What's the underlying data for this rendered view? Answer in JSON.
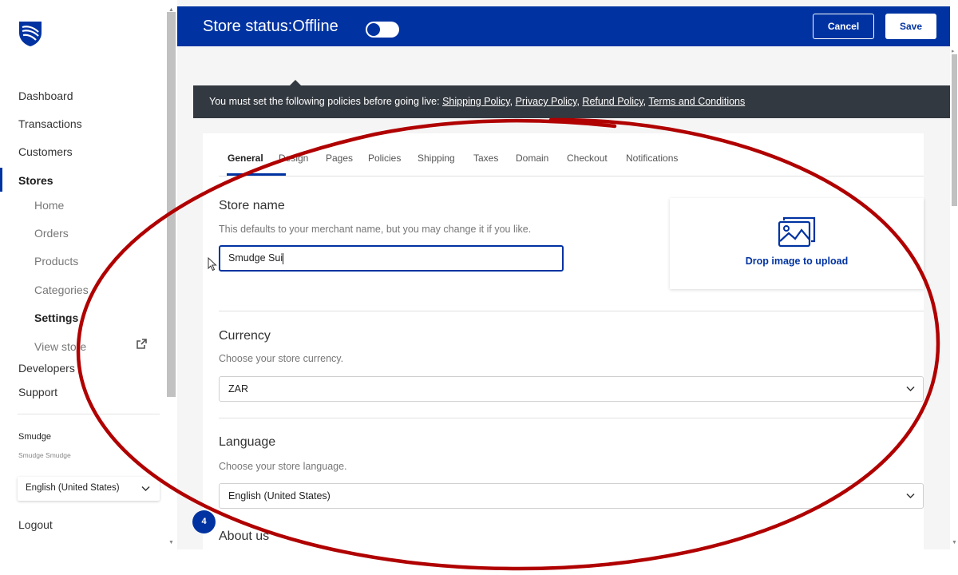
{
  "sidebar": {
    "nav": {
      "dashboard": "Dashboard",
      "transactions": "Transactions",
      "customers": "Customers",
      "stores": "Stores",
      "developers": "Developers",
      "support": "Support"
    },
    "stores_sub": {
      "home": "Home",
      "orders": "Orders",
      "products": "Products",
      "categories": "Categories",
      "settings": "Settings",
      "view_store": "View store"
    },
    "merchant": {
      "name": "Smudge",
      "subtitle": "Smudge Smudge"
    },
    "language_selected": "English (United States)",
    "logout": "Logout"
  },
  "header": {
    "store_status": "Store status:Offline",
    "toggle_on": false,
    "cancel_label": "Cancel",
    "save_label": "Save"
  },
  "policy_banner": {
    "prefix": "You must set the following policies before going live:",
    "links": [
      "Shipping Policy",
      "Privacy Policy",
      "Refund Policy",
      "Terms and Conditions"
    ]
  },
  "tabs": [
    "General",
    "Design",
    "Pages",
    "Policies",
    "Shipping",
    "Taxes",
    "Domain",
    "Checkout",
    "Notifications"
  ],
  "active_tab": "General",
  "general": {
    "store_name": {
      "title": "Store name",
      "description": "This defaults to your merchant name, but you may change it if you like.",
      "value": "Smudge Sui"
    },
    "upload": {
      "label": "Drop image to upload"
    },
    "currency": {
      "title": "Currency",
      "description": "Choose your store currency.",
      "value": "ZAR"
    },
    "language": {
      "title": "Language",
      "description": "Choose your store language.",
      "value": "English (United States)"
    },
    "about": {
      "title": "About us"
    }
  },
  "badge_count": "4",
  "colors": {
    "primary": "#0033a1",
    "banner": "#333940",
    "annotation": "#b00000"
  },
  "icons": [
    "bank-logo-icon",
    "external-link-icon",
    "chevron-down-icon",
    "image-upload-icon",
    "mouse-cursor-icon"
  ]
}
